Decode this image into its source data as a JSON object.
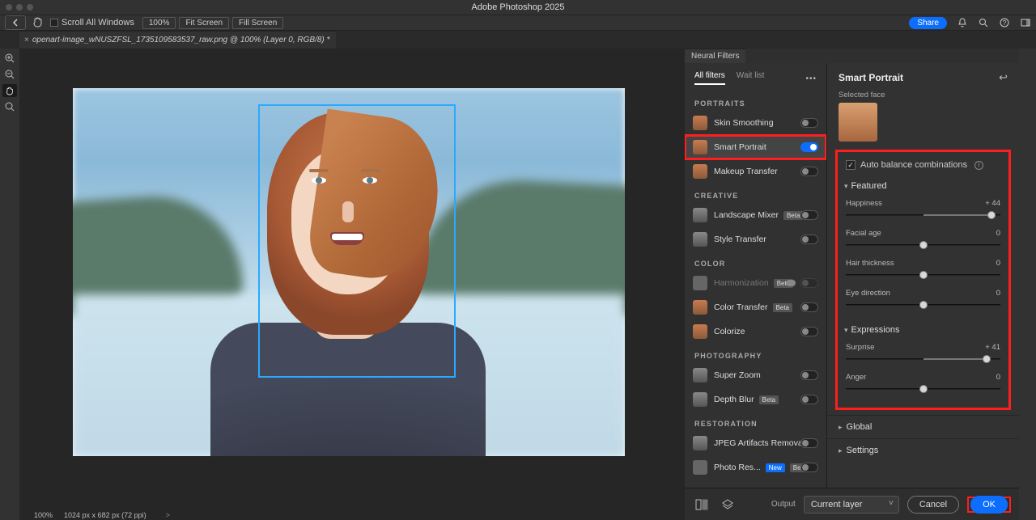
{
  "app": {
    "title": "Adobe Photoshop 2025"
  },
  "optbar": {
    "scroll_all": "Scroll All Windows",
    "zoom": "100%",
    "fit": "Fit Screen",
    "fill": "Fill Screen",
    "share": "Share"
  },
  "doc_tab": "openart-image_wNUSZFSL_1735109583537_raw.png @ 100% (Layer 0, RGB/8) *",
  "status": {
    "zoom": "100%",
    "info": "1024 px x 682 px (72 ppi)",
    "rule": ">"
  },
  "neural": {
    "panel_title": "Neural Filters",
    "tabs": {
      "all": "All filters",
      "wait": "Wait list"
    },
    "cats": {
      "portraits": "PORTRAITS",
      "creative": "CREATIVE",
      "color": "COLOR",
      "photography": "PHOTOGRAPHY",
      "restoration": "RESTORATION"
    },
    "filters": {
      "skin": "Skin Smoothing",
      "smart_portrait": "Smart Portrait",
      "makeup": "Makeup Transfer",
      "landscape": "Landscape Mixer",
      "style": "Style Transfer",
      "harmo": "Harmonization",
      "ctransfer": "Color Transfer",
      "colorize": "Colorize",
      "superzoom": "Super Zoom",
      "depth": "Depth Blur",
      "jpeg": "JPEG Artifacts Removal",
      "photores": "Photo Res..."
    },
    "badges": {
      "beta": "Beta",
      "new": "New"
    }
  },
  "detail": {
    "title": "Smart Portrait",
    "selected_face_label": "Selected face",
    "auto_balance": "Auto balance combinations",
    "featured": "Featured",
    "expressions": "Expressions",
    "global": "Global",
    "settings": "Settings",
    "sliders": {
      "happiness": {
        "label": "Happiness",
        "value": "+ 44",
        "pos": 94,
        "fill_from": 50,
        "fill_to": 94
      },
      "facial_age": {
        "label": "Facial age",
        "value": "0",
        "pos": 50
      },
      "hair": {
        "label": "Hair thickness",
        "value": "0",
        "pos": 50
      },
      "eye": {
        "label": "Eye direction",
        "value": "0",
        "pos": 50
      },
      "surprise": {
        "label": "Surprise",
        "value": "+ 41",
        "pos": 91,
        "fill_from": 50,
        "fill_to": 91
      },
      "anger": {
        "label": "Anger",
        "value": "0",
        "pos": 50
      }
    }
  },
  "footer": {
    "output_label": "Output",
    "output_select": "Current layer",
    "cancel": "Cancel",
    "ok": "OK"
  }
}
